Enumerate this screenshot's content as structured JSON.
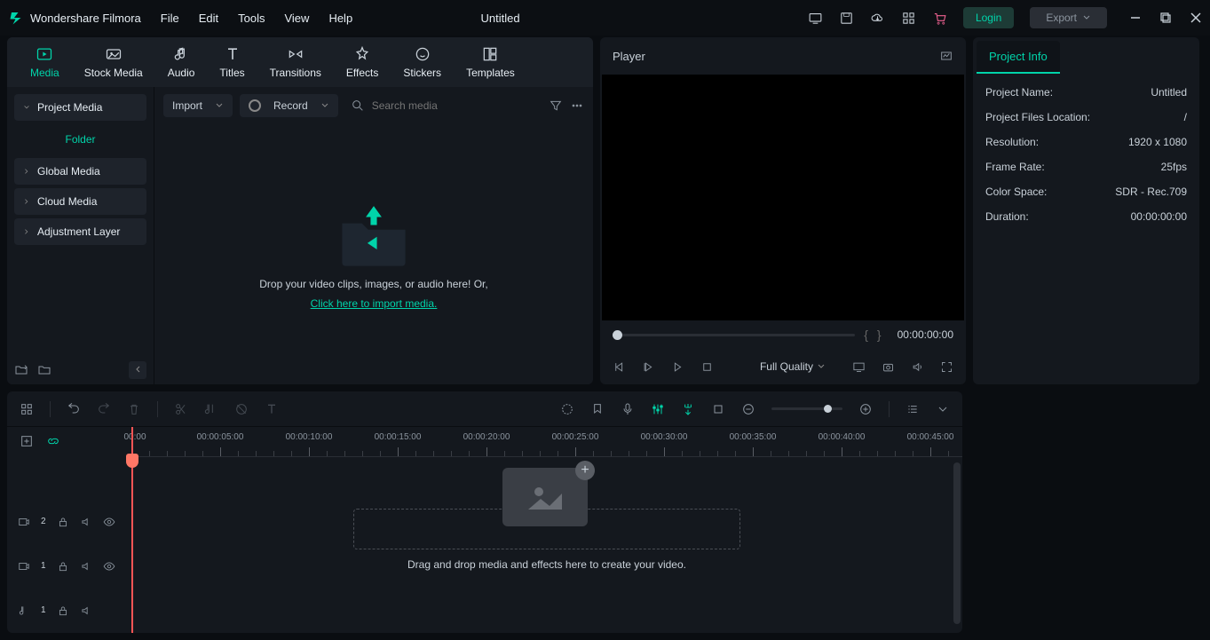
{
  "app": {
    "name": "Wondershare Filmora",
    "doc_title": "Untitled"
  },
  "menu": [
    "File",
    "Edit",
    "Tools",
    "View",
    "Help"
  ],
  "header": {
    "login": "Login",
    "export": "Export"
  },
  "tabs": [
    {
      "id": "media",
      "label": "Media"
    },
    {
      "id": "stock",
      "label": "Stock Media"
    },
    {
      "id": "audio",
      "label": "Audio"
    },
    {
      "id": "titles",
      "label": "Titles"
    },
    {
      "id": "transitions",
      "label": "Transitions"
    },
    {
      "id": "effects",
      "label": "Effects"
    },
    {
      "id": "stickers",
      "label": "Stickers"
    },
    {
      "id": "templates",
      "label": "Templates"
    }
  ],
  "sidebar": {
    "items": [
      "Project Media",
      "Global Media",
      "Cloud Media",
      "Adjustment Layer"
    ],
    "folder": "Folder"
  },
  "media": {
    "import": "Import",
    "record": "Record",
    "search_placeholder": "Search media",
    "drop_text": "Drop your video clips, images, or audio here! Or,",
    "import_link": "Click here to import media."
  },
  "player": {
    "title": "Player",
    "time": "00:00:00:00",
    "quality": "Full Quality"
  },
  "info": {
    "tab": "Project Info",
    "rows": [
      {
        "k": "Project Name:",
        "v": "Untitled"
      },
      {
        "k": "Project Files Location:",
        "v": "/"
      },
      {
        "k": "Resolution:",
        "v": "1920 x 1080"
      },
      {
        "k": "Frame Rate:",
        "v": "25fps"
      },
      {
        "k": "Color Space:",
        "v": "SDR - Rec.709"
      },
      {
        "k": "Duration:",
        "v": "00:00:00:00"
      }
    ]
  },
  "timeline": {
    "ruler_start": "00:00",
    "ticks": [
      "00:00:05:00",
      "00:00:10:00",
      "00:00:15:00",
      "00:00:20:00",
      "00:00:25:00",
      "00:00:30:00",
      "00:00:35:00",
      "00:00:40:00",
      "00:00:45:00"
    ],
    "hint": "Drag and drop media and effects here to create your video.",
    "tracks": [
      {
        "label": "2"
      },
      {
        "label": "1"
      },
      {
        "label": "1"
      }
    ]
  }
}
